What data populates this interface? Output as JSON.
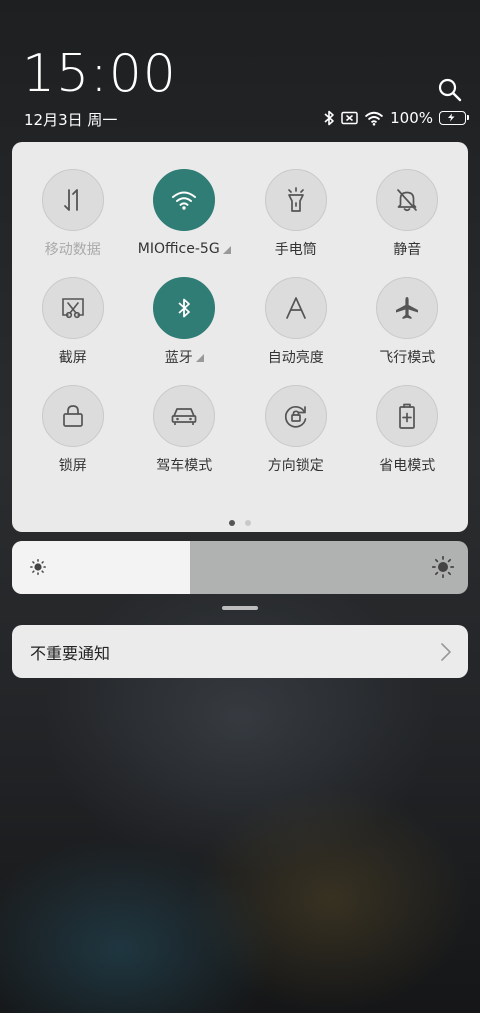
{
  "header": {
    "time": "15:00",
    "date": "12月3日 周一"
  },
  "status_bar": {
    "battery_text": "100%",
    "battery_color": "#3ecf5e"
  },
  "quick_settings": {
    "accent_color": "#2f7d74",
    "tiles": [
      {
        "label": "移动数据",
        "icon": "mobile-data-icon",
        "active": false
      },
      {
        "label": "MIOffice-5G",
        "icon": "wifi-icon",
        "active": true
      },
      {
        "label": "手电筒",
        "icon": "flashlight-icon",
        "active": false
      },
      {
        "label": "静音",
        "icon": "mute-bell-icon",
        "active": false
      },
      {
        "label": "截屏",
        "icon": "screenshot-icon",
        "active": false
      },
      {
        "label": "蓝牙",
        "icon": "bluetooth-icon",
        "active": true
      },
      {
        "label": "自动亮度",
        "icon": "auto-brightness-icon",
        "active": false
      },
      {
        "label": "飞行模式",
        "icon": "airplane-icon",
        "active": false
      },
      {
        "label": "锁屏",
        "icon": "lock-icon",
        "active": false
      },
      {
        "label": "驾车模式",
        "icon": "car-icon",
        "active": false
      },
      {
        "label": "方向锁定",
        "icon": "rotation-lock-icon",
        "active": false
      },
      {
        "label": "省电模式",
        "icon": "battery-saver-icon",
        "active": false
      }
    ],
    "page_count": 2,
    "current_page": 1
  },
  "brightness": {
    "level_fraction": 0.39
  },
  "notifications": {
    "unimportant_label": "不重要通知"
  }
}
